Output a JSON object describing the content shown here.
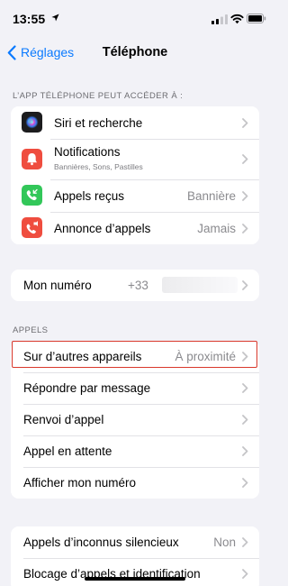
{
  "status_bar": {
    "time": "13:55"
  },
  "nav": {
    "back_label": "Réglages",
    "title": "Téléphone"
  },
  "sections": {
    "access_header": "L’APP TÉLÉPHONE PEUT ACCÉDER À :",
    "calls_header": "APPELS"
  },
  "access_rows": [
    {
      "label": "Siri et recherche",
      "icon": "siri-icon"
    },
    {
      "label": "Notifications",
      "sublabel": "Bannières, Sons, Pastilles",
      "icon": "bell-icon"
    },
    {
      "label": "Appels reçus",
      "value": "Bannière",
      "icon": "incoming-call-icon"
    },
    {
      "label": "Annonce d’appels",
      "value": "Jamais",
      "icon": "announce-call-icon"
    }
  ],
  "my_number": {
    "label": "Mon numéro",
    "value": "+33"
  },
  "calls_rows": [
    {
      "label": "Sur d’autres appareils",
      "value": "À proximité"
    },
    {
      "label": "Répondre par message"
    },
    {
      "label": "Renvoi d’appel"
    },
    {
      "label": "Appel en attente"
    },
    {
      "label": "Afficher mon numéro"
    }
  ],
  "silence_rows": [
    {
      "label": "Appels d’inconnus silencieux",
      "value": "Non"
    },
    {
      "label": "Blocage d’appels et identification"
    }
  ],
  "colors": {
    "accent": "#0a7aff",
    "background": "#f2f2f7",
    "highlight": "#d9382c",
    "icon_red": "#ef4d3f",
    "icon_green": "#32c759"
  }
}
